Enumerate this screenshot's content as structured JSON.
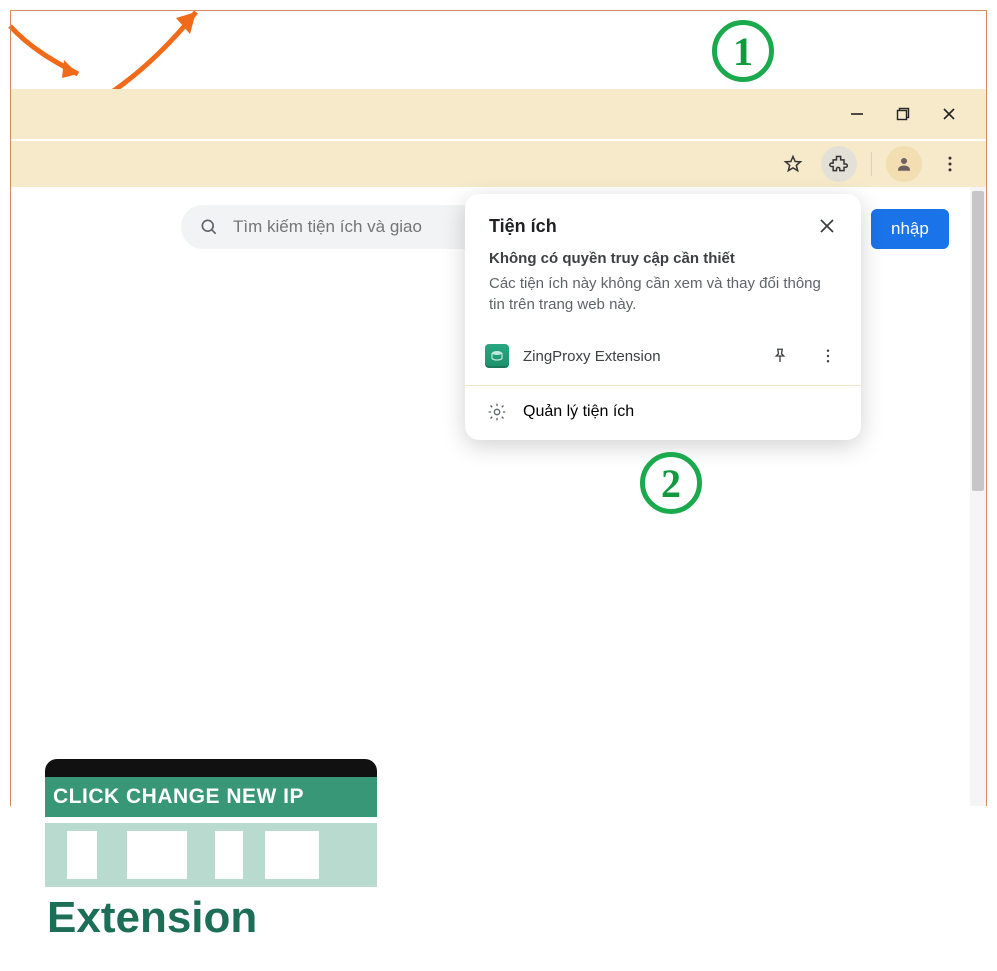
{
  "titlebar": {
    "minimize": "–",
    "maximize": "❐",
    "close": "✕"
  },
  "toolbar": {
    "star": "star-icon",
    "extensions": "extensions-icon",
    "profile": "profile-icon",
    "menu": "menu-icon"
  },
  "search": {
    "placeholder": "Tìm kiếm tiện ích và giao"
  },
  "login_button": "nhập",
  "popup": {
    "title": "Tiện ích",
    "subtitle": "Không có quyền truy cập cần thiết",
    "description": "Các tiện ích này không cần xem và thay đổi thông tin trên trang web này.",
    "items": [
      {
        "name": "ZingProxy Extension"
      }
    ],
    "manage_label": "Quản lý tiện ích"
  },
  "annotations": {
    "step1": "1",
    "step2": "2"
  },
  "thumbnail": {
    "banner": "CLICK CHANGE NEW IP",
    "title": "Extension"
  }
}
